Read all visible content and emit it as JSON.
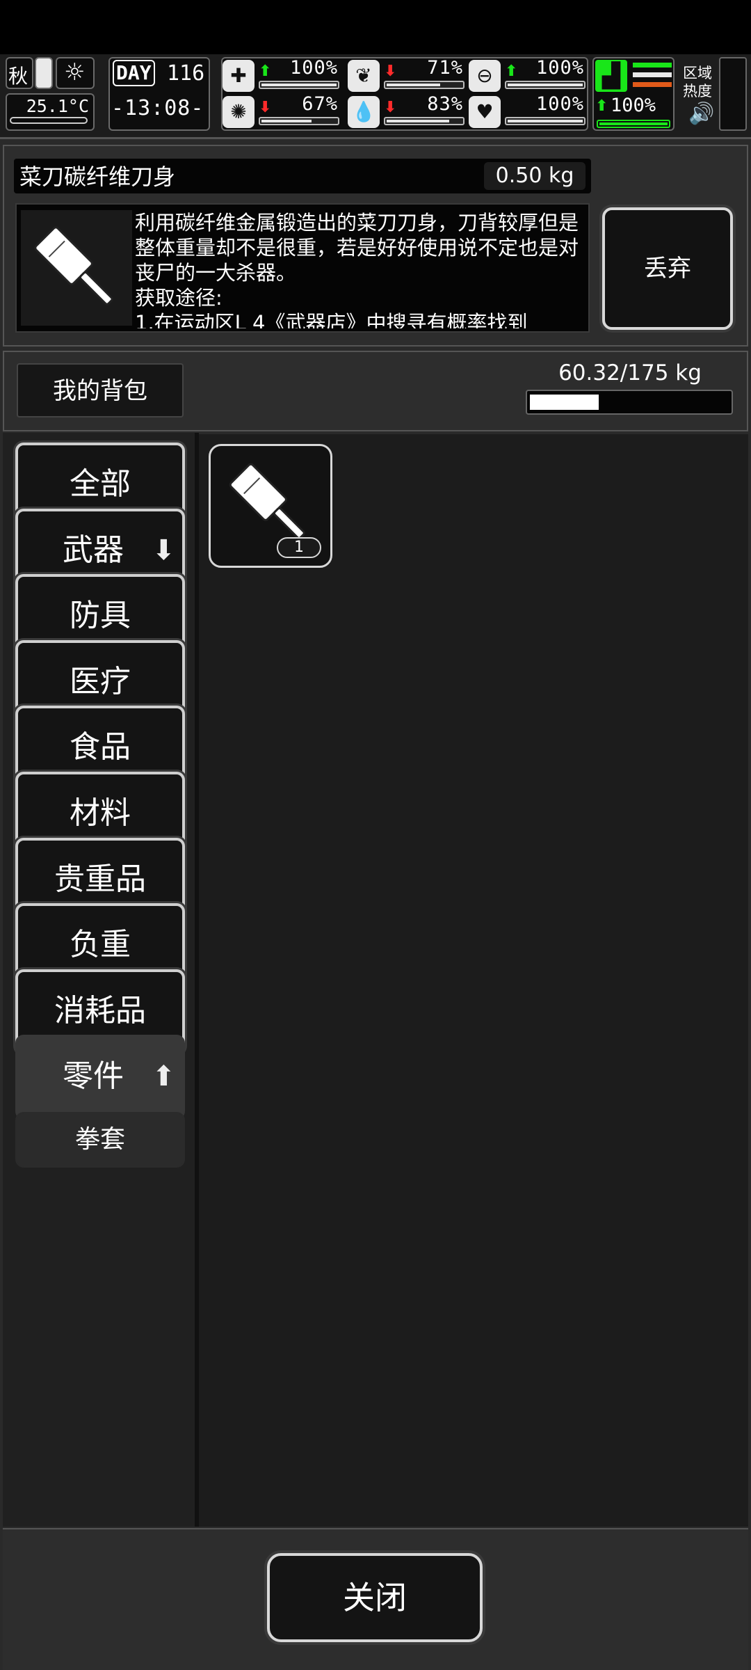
{
  "hud": {
    "season": "秋",
    "temperature": "25.1°C",
    "day_label": "DAY",
    "day_number": "116",
    "time": "-13:08-",
    "stats": [
      {
        "icon": "medkit-icon",
        "trend": "up",
        "percent": "100%",
        "level": 1.0
      },
      {
        "icon": "stomach-icon",
        "trend": "down",
        "percent": "71%",
        "level": 0.71
      },
      {
        "icon": "pill-icon",
        "trend": "up",
        "percent": "100%",
        "level": 1.0
      },
      {
        "icon": "brain-icon",
        "trend": "down",
        "percent": "67%",
        "level": 0.67
      },
      {
        "icon": "water-drop-icon",
        "trend": "down",
        "percent": "83%",
        "level": 0.83
      },
      {
        "icon": "heart-icon",
        "trend": "none",
        "percent": "100%",
        "level": 1.0
      }
    ],
    "stamina": {
      "icon": "boot-icon",
      "trend": "up",
      "percent": "100%",
      "level": 1.0
    },
    "zone_heat_label": "区域\n热度",
    "colors": {
      "stamina_green": "#19e619",
      "hunger_orange": "#e05a1a",
      "up_arrow": "#19e619",
      "down_arrow": "#ff2b2b"
    }
  },
  "item": {
    "name": "菜刀碳纤维刀身",
    "weight": "0.50 kg",
    "description": "利用碳纤维金属锻造出的菜刀刀身，刀背较厚但是整体重量却不是很重，若是好好使用说不定也是对丧尸的一大杀器。",
    "source_label": "获取途径:",
    "source_line": "1.在运动区L 4《武器店》中搜寻有概率找到",
    "icon": "cleaver-icon"
  },
  "discard_label": "丢弃",
  "backpack": {
    "tab_label": "我的背包",
    "capacity": "60.32/175 kg",
    "fill_ratio": 0.3447
  },
  "categories": [
    {
      "label": "全部",
      "dir": ""
    },
    {
      "label": "武器",
      "dir": "down"
    },
    {
      "label": "防具",
      "dir": ""
    },
    {
      "label": "医疗",
      "dir": ""
    },
    {
      "label": "食品",
      "dir": ""
    },
    {
      "label": "材料",
      "dir": ""
    },
    {
      "label": "贵重品",
      "dir": ""
    },
    {
      "label": "负重",
      "dir": ""
    },
    {
      "label": "消耗品",
      "dir": ""
    },
    {
      "label": "零件",
      "dir": "up"
    },
    {
      "label": "拳套",
      "dir": ""
    }
  ],
  "slots": [
    {
      "icon": "cleaver-icon",
      "count": "1"
    }
  ],
  "close_label": "关闭"
}
